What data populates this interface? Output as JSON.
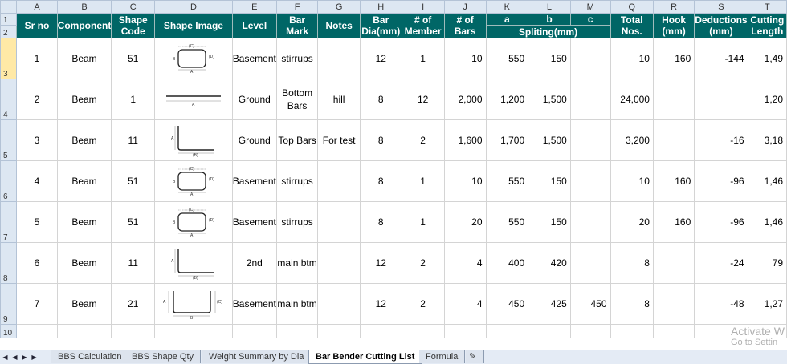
{
  "columns": [
    "A",
    "B",
    "C",
    "D",
    "E",
    "F",
    "G",
    "H",
    "I",
    "J",
    "K",
    "L",
    "M",
    "Q",
    "R",
    "S",
    "T"
  ],
  "row_numbers": [
    "1",
    "2",
    "3",
    "4",
    "5",
    "6",
    "7",
    "8",
    "9",
    "10"
  ],
  "headers": {
    "sr_no": "Sr no",
    "component": "Component",
    "shape_code": "Shape Code",
    "shape_image": "Shape Image",
    "level": "Level",
    "bar_mark": "Bar Mark",
    "notes": "Notes",
    "bar_dia": "Bar Dia(mm)",
    "num_member": "# of Member",
    "num_bars": "# of Bars",
    "a": "a",
    "b": "b",
    "c": "c",
    "spliting": "Spliting(mm)",
    "total_nos": "Total Nos.",
    "hook": "Hook (mm)",
    "deductions": "Deductions (mm)",
    "cutting_length": "Cutting Length"
  },
  "rows": [
    {
      "sr": "1",
      "component": "Beam",
      "shape_code": "51",
      "shape": "stirrup",
      "level": "Basement",
      "bar_mark": "stirrups",
      "notes": "",
      "dia": "12",
      "member": "1",
      "bars": "10",
      "a": "550",
      "b": "150",
      "c": "",
      "total": "10",
      "hook": "160",
      "deduction": "-144",
      "cutting": "1,49"
    },
    {
      "sr": "2",
      "component": "Beam",
      "shape_code": "1",
      "shape": "straight",
      "level": "Ground",
      "bar_mark": "Bottom Bars",
      "notes": "hill",
      "dia": "8",
      "member": "12",
      "bars": "2,000",
      "a": "1,200",
      "b": "1,500",
      "c": "",
      "total": "24,000",
      "hook": "",
      "deduction": "",
      "cutting": "1,20"
    },
    {
      "sr": "3",
      "component": "Beam",
      "shape_code": "11",
      "shape": "L",
      "level": "Ground",
      "bar_mark": "Top Bars",
      "notes": "For test",
      "dia": "8",
      "member": "2",
      "bars": "1,600",
      "a": "1,700",
      "b": "1,500",
      "c": "",
      "total": "3,200",
      "hook": "",
      "deduction": "-16",
      "cutting": "3,18"
    },
    {
      "sr": "4",
      "component": "Beam",
      "shape_code": "51",
      "shape": "stirrup",
      "level": "Basement",
      "bar_mark": "stirrups",
      "notes": "",
      "dia": "8",
      "member": "1",
      "bars": "10",
      "a": "550",
      "b": "150",
      "c": "",
      "total": "10",
      "hook": "160",
      "deduction": "-96",
      "cutting": "1,46"
    },
    {
      "sr": "5",
      "component": "Beam",
      "shape_code": "51",
      "shape": "stirrup",
      "level": "Basement",
      "bar_mark": "stirrups",
      "notes": "",
      "dia": "8",
      "member": "1",
      "bars": "20",
      "a": "550",
      "b": "150",
      "c": "",
      "total": "20",
      "hook": "160",
      "deduction": "-96",
      "cutting": "1,46"
    },
    {
      "sr": "6",
      "component": "Beam",
      "shape_code": "11",
      "shape": "L",
      "level": "2nd",
      "bar_mark": "main btm",
      "notes": "",
      "dia": "12",
      "member": "2",
      "bars": "4",
      "a": "400",
      "b": "420",
      "c": "",
      "total": "8",
      "hook": "",
      "deduction": "-24",
      "cutting": "79"
    },
    {
      "sr": "7",
      "component": "Beam",
      "shape_code": "21",
      "shape": "U",
      "level": "Basement",
      "bar_mark": "main btm",
      "notes": "",
      "dia": "12",
      "member": "2",
      "bars": "4",
      "a": "450",
      "b": "425",
      "c": "450",
      "total": "8",
      "hook": "",
      "deduction": "-48",
      "cutting": "1,27"
    }
  ],
  "shape_labels": {
    "a": "A",
    "b": "B",
    "c": "(C)",
    "d": "(D)"
  },
  "tabs": [
    "BBS Calculation",
    "BBS Shape Qty",
    "Weight Summary by Dia",
    "Bar Bender Cutting List",
    "Formula"
  ],
  "active_tab": "Bar Bender Cutting List",
  "watermark": {
    "line1": "Activate W",
    "line2": "Go to Settin"
  },
  "colors": {
    "header_bg": "#006666",
    "header_text": "#ffffff",
    "selected_row": "#ffe9a6"
  }
}
